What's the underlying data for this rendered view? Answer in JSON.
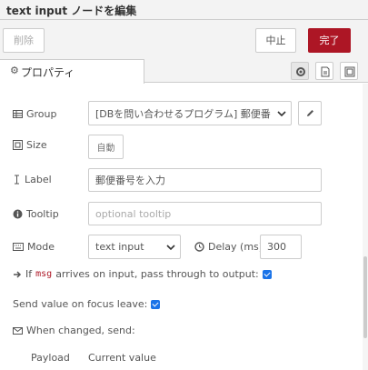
{
  "header": {
    "title": "text input ノードを編集"
  },
  "buttons": {
    "delete": "削除",
    "cancel": "中止",
    "done": "完了"
  },
  "tabs": [
    {
      "label": "プロパティ",
      "icon": "gear-icon"
    }
  ],
  "tab_icons": [
    "gear-icon",
    "document-icon",
    "layout-icon"
  ],
  "form": {
    "group": {
      "label": "Group",
      "value": "[DBを問い合わせるプログラム] 郵便番"
    },
    "size": {
      "label": "Size",
      "button": "自動"
    },
    "label": {
      "label": "Label",
      "value": "郵便番号を入力"
    },
    "tooltip": {
      "label": "Tooltip",
      "placeholder": "optional tooltip"
    },
    "mode": {
      "label": "Mode",
      "value": "text input",
      "delay_label": "Delay (ms)",
      "delay_value": "300"
    },
    "pass_through": {
      "prefix": "If",
      "code": "msg",
      "suffix": "arrives on input, pass through to output:",
      "checked": true
    },
    "focus_leave": {
      "label": "Send value on focus leave:",
      "checked": true
    },
    "when_changed": {
      "label": "When changed, send:"
    },
    "payload": {
      "label": "Payload",
      "value": "Current value"
    }
  }
}
